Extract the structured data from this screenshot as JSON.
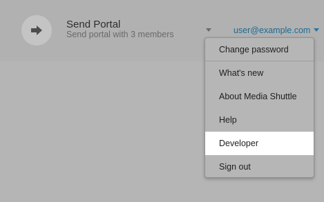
{
  "portal": {
    "icon": "arrow-right-icon",
    "title": "Send Portal",
    "subtitle": "Send portal with 3 members"
  },
  "user": {
    "email": "user@example.com"
  },
  "menu": {
    "items": [
      {
        "label": "Change password"
      },
      {
        "label": "What's new"
      },
      {
        "label": "About Media Shuttle"
      },
      {
        "label": "Help"
      },
      {
        "label": "Developer",
        "highlighted": true
      },
      {
        "label": "Sign out"
      }
    ]
  },
  "colors": {
    "accent": "#1d6a93",
    "highlight": "#ffffff"
  }
}
